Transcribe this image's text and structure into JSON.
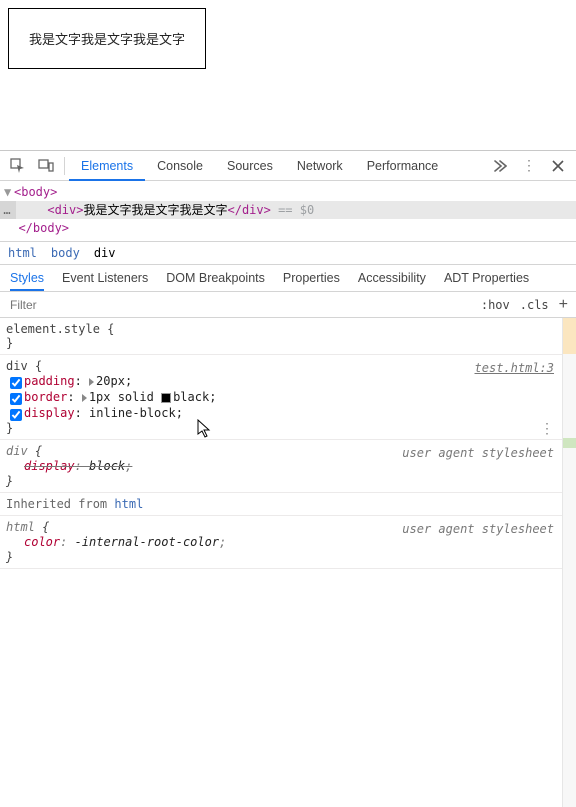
{
  "page": {
    "demo_text": "我是文字我是文字我是文字"
  },
  "devtools": {
    "tabs": [
      "Elements",
      "Console",
      "Sources",
      "Network",
      "Performance"
    ],
    "active_tab": 0,
    "dom": {
      "body_open": "<body>",
      "sel_open": "<div>",
      "sel_text": "我是文字我是文字我是文字",
      "sel_close": "</div>",
      "sel_hint": " == $0",
      "body_close": "</body>"
    },
    "crumbs": [
      "html",
      "body",
      "div"
    ],
    "sub_tabs": [
      "Styles",
      "Event Listeners",
      "DOM Breakpoints",
      "Properties",
      "Accessibility",
      "ADT Properties"
    ],
    "active_sub": 0,
    "filter": {
      "placeholder": "Filter",
      "hov": ":hov",
      "cls": ".cls"
    },
    "element_style": {
      "selector": "element.style",
      "open": " {",
      "close": "}"
    },
    "rule_div": {
      "selector": "div",
      "open": " {",
      "close": "}",
      "link": "test.html:3",
      "decls": [
        {
          "prop": "padding",
          "val": "20px",
          "indicator": "tri"
        },
        {
          "prop": "border",
          "val": "1px solid black",
          "indicator": "tri_swatch"
        },
        {
          "prop": "display",
          "val": "inline-block",
          "indicator": ""
        }
      ]
    },
    "rule_ua_div": {
      "selector": "div",
      "open": " {",
      "close": "}",
      "label": "user agent stylesheet",
      "decl": {
        "prop": "display",
        "val": "block"
      }
    },
    "inherit_label": "Inherited from",
    "inherit_from": "html",
    "rule_ua_html": {
      "selector": "html",
      "open": " {",
      "close": "}",
      "label": "user agent stylesheet",
      "decl": {
        "prop": "color",
        "val": "-internal-root-color"
      }
    }
  }
}
